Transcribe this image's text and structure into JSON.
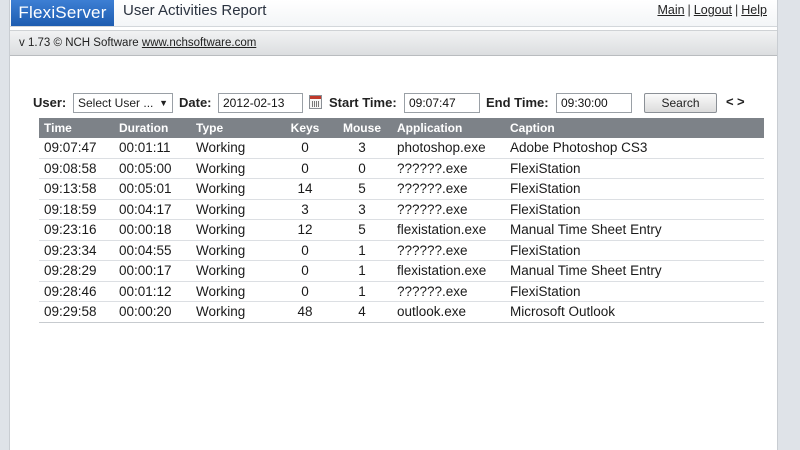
{
  "header": {
    "logo": "FlexiServer",
    "title": "User Activities Report",
    "nav": [
      "Main",
      "Logout",
      "Help"
    ],
    "nav_sep": "|"
  },
  "version_bar": {
    "text": "v 1.73 © NCH Software",
    "link": "www.nchsoftware.com"
  },
  "filters": {
    "user_label": "User:",
    "user_value": "Select User ...",
    "date_label": "Date:",
    "date_value": "2012-02-13",
    "start_label": "Start Time:",
    "start_value": "09:07:47",
    "end_label": "End Time:",
    "end_value": "09:30:00",
    "search_label": "Search",
    "prev": "<",
    "next": ">"
  },
  "table": {
    "columns": [
      "Time",
      "Duration",
      "Type",
      "Keys",
      "Mouse",
      "Application",
      "Caption"
    ],
    "rows": [
      [
        "09:07:47",
        "00:01:11",
        "Working",
        "0",
        "3",
        "photoshop.exe",
        "Adobe Photoshop CS3"
      ],
      [
        "09:08:58",
        "00:05:00",
        "Working",
        "0",
        "0",
        "??????.exe",
        "FlexiStation"
      ],
      [
        "09:13:58",
        "00:05:01",
        "Working",
        "14",
        "5",
        "??????.exe",
        "FlexiStation"
      ],
      [
        "09:18:59",
        "00:04:17",
        "Working",
        "3",
        "3",
        "??????.exe",
        "FlexiStation"
      ],
      [
        "09:23:16",
        "00:00:18",
        "Working",
        "12",
        "5",
        "flexistation.exe",
        "Manual Time Sheet Entry"
      ],
      [
        "09:23:34",
        "00:04:55",
        "Working",
        "0",
        "1",
        "??????.exe",
        "FlexiStation"
      ],
      [
        "09:28:29",
        "00:00:17",
        "Working",
        "0",
        "1",
        "flexistation.exe",
        "Manual Time Sheet Entry"
      ],
      [
        "09:28:46",
        "00:01:12",
        "Working",
        "0",
        "1",
        "??????.exe",
        "FlexiStation"
      ],
      [
        "09:29:58",
        "00:00:20",
        "Working",
        "48",
        "4",
        "outlook.exe",
        "Microsoft Outlook"
      ]
    ]
  },
  "colors": {
    "logo_bg": "#2a6cc4",
    "table_header_bg": "#7d8288",
    "page_bg": "#dfe3e8"
  }
}
